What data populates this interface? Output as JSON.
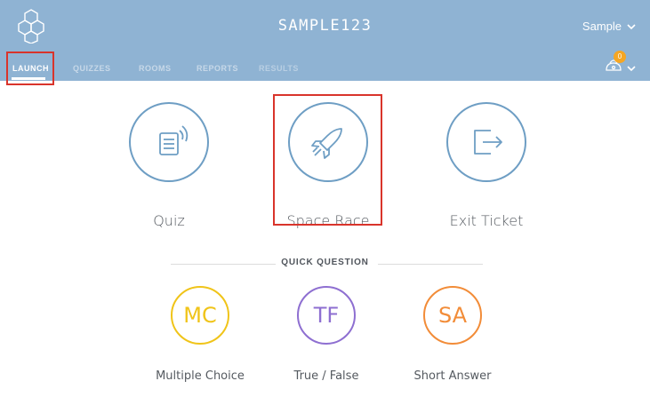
{
  "header": {
    "room_name": "SAMPLE123",
    "user_label": "Sample",
    "notification_count": "0"
  },
  "nav": {
    "tabs": [
      {
        "label": "LAUNCH",
        "state": "active"
      },
      {
        "label": "QUIZZES",
        "state": "normal"
      },
      {
        "label": "ROOMS",
        "state": "normal"
      },
      {
        "label": "REPORTS",
        "state": "normal"
      },
      {
        "label": "RESULTS",
        "state": "disabled"
      }
    ]
  },
  "activities": [
    {
      "label": "Quiz",
      "icon": "quiz-icon"
    },
    {
      "label": "Space Race",
      "icon": "rocket-icon"
    },
    {
      "label": "Exit Ticket",
      "icon": "exit-ticket-icon"
    }
  ],
  "quick_question": {
    "title": "QUICK QUESTION",
    "items": [
      {
        "abbr": "MC",
        "label": "Multiple Choice",
        "color": "#f0c419"
      },
      {
        "abbr": "TF",
        "label": "True / False",
        "color": "#8e6fd1"
      },
      {
        "abbr": "SA",
        "label": "Short Answer",
        "color": "#f28c38"
      }
    ]
  },
  "colors": {
    "header_bg": "#8fb3d3",
    "activity_ring": "#6e9ec4",
    "highlight": "#d9342b",
    "badge": "#f5a623"
  }
}
